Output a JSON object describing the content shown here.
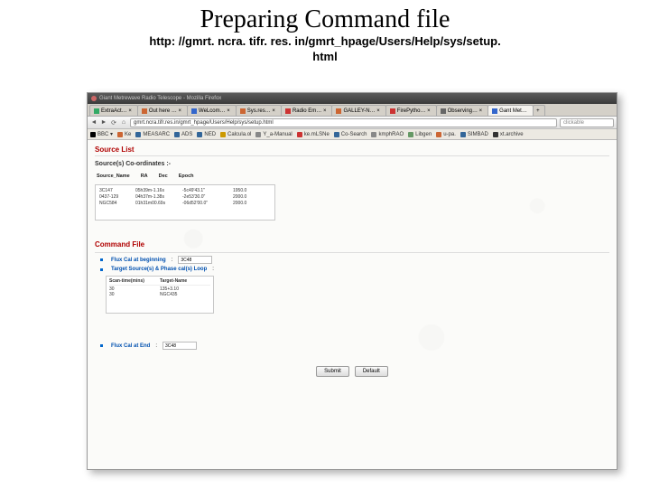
{
  "slide": {
    "title": "Preparing Command file",
    "url_line1": "http: //gmrt. ncra. tifr. res. in/gmrt_hpage/Users/Help/sys/setup.",
    "url_line2": "html"
  },
  "browser": {
    "titlebar": "Giant Metrewave Radio Telescope - Mozilla Firefox",
    "tabs": [
      {
        "label": "ExtraAct… ×",
        "color": "#3a6"
      },
      {
        "label": "Out here … ×",
        "color": "#c63"
      },
      {
        "label": "WeLcom… ×",
        "color": "#36c"
      },
      {
        "label": "Sys.res… ×",
        "color": "#c63"
      },
      {
        "label": "Radio Em… ×",
        "color": "#c33"
      },
      {
        "label": "GALLEY-N… ×",
        "color": "#c63"
      },
      {
        "label": "FirePytho… ×",
        "color": "#c33"
      },
      {
        "label": "Observing… ×",
        "color": "#666"
      },
      {
        "label": "Gant Met…",
        "color": "#36c",
        "active": true
      }
    ],
    "url": "gmrt.ncra.tifr.res.in/gmrt_hpage/Users/Help/sys/setup.html",
    "search_placeholder": "clickable",
    "bookmarks": [
      {
        "label": "BBC ▾",
        "color": "#000"
      },
      {
        "label": "Ke",
        "color": "#c63"
      },
      {
        "label": "MEASARC",
        "color": "#369"
      },
      {
        "label": "ADS",
        "color": "#369"
      },
      {
        "label": "NED",
        "color": "#369"
      },
      {
        "label": "Calcula.ol",
        "color": "#c90"
      },
      {
        "label": "Y_a-Manual",
        "color": "#888"
      },
      {
        "label": "ke.mLSNe",
        "color": "#c33"
      },
      {
        "label": "Co-Search",
        "color": "#369"
      },
      {
        "label": "kmphRAO",
        "color": "#888"
      },
      {
        "label": "Libgen",
        "color": "#696"
      },
      {
        "label": "u-pa.",
        "color": "#c63"
      },
      {
        "label": "SIMBAD",
        "color": "#369"
      },
      {
        "label": "xt.archive",
        "color": "#333"
      }
    ]
  },
  "page": {
    "source_list": "Source List",
    "coords_label": "Source(s) Co-ordinates :-",
    "coord_headers": {
      "name": "Source_Name",
      "ra": "RA",
      "dec": "Dec",
      "epoch": "Epoch"
    },
    "coord_rows": [
      {
        "name": "3C147",
        "ra": "05h39m-1.16s",
        "dec": "-5c49'43.1\"",
        "epoch": "1950.0"
      },
      {
        "name": "0437-129",
        "ra": "04h37m-1.38s",
        "dec": "-2e53'30.0\"",
        "epoch": "2000.0"
      },
      {
        "name": "NGC584",
        "ra": "01h31m00.69s",
        "dec": "-06d52'00.0\"",
        "epoch": "2000.0"
      }
    ],
    "command_file": "Command File",
    "flux_begin_label": "Flux Cal at beginning",
    "flux_begin_val": "3C48",
    "loop_label": "Target Source(s) & Phase cal(s) Loop",
    "loop_headers": {
      "scan": "Scan-time(mins)",
      "targ": "Target-Name"
    },
    "loop_rows": [
      {
        "scan": "30",
        "targ": "135+3.10"
      },
      {
        "scan": "30",
        "targ": "NGC435"
      }
    ],
    "flux_end_label": "Flux Cal at End",
    "flux_end_val": "3C48",
    "btn_submit": "Submit",
    "btn_default": "Default"
  }
}
